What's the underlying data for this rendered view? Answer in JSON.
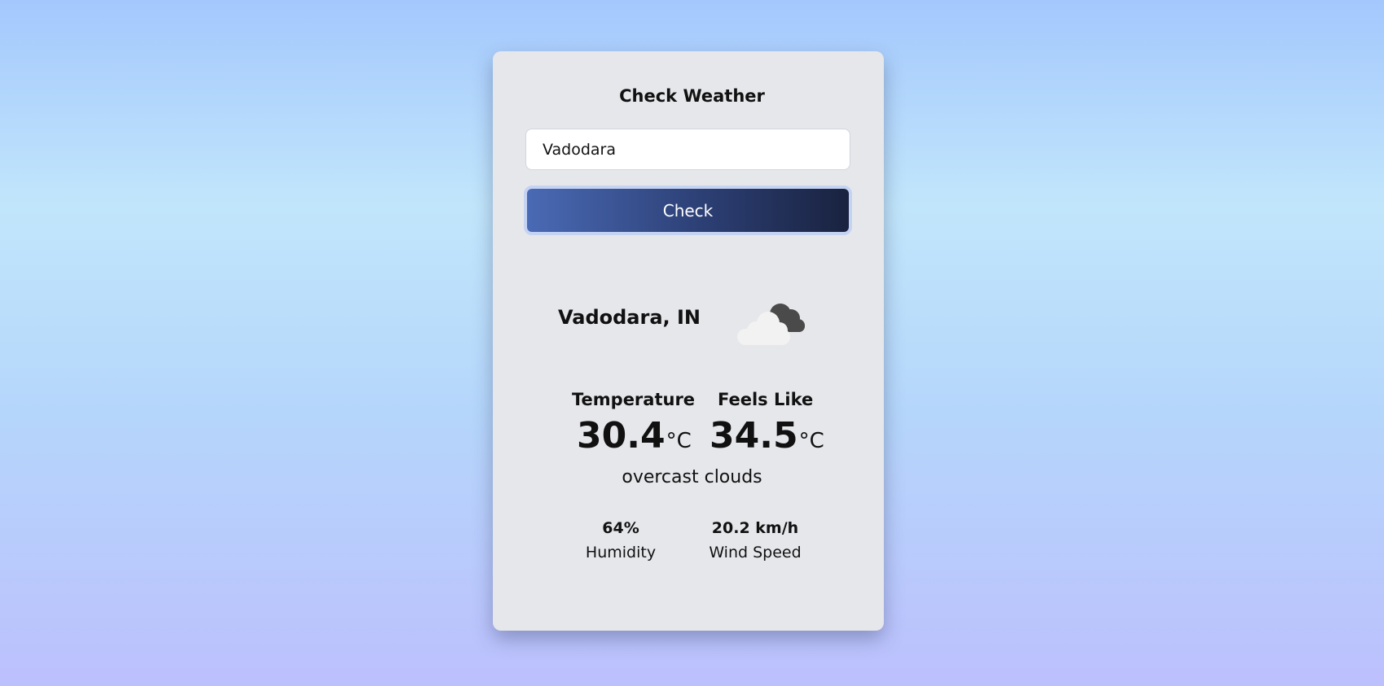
{
  "form": {
    "title": "Check Weather",
    "city_value": "Vadodara",
    "button_label": "Check"
  },
  "result": {
    "location": "Vadodara, IN",
    "icon": "overcast-clouds-icon",
    "temperature": {
      "label": "Temperature",
      "value": "30.4",
      "unit": "°C"
    },
    "feels_like": {
      "label": "Feels Like",
      "value": "34.5",
      "unit": "°C"
    },
    "description": "overcast clouds",
    "humidity": {
      "value": "64%",
      "label": "Humidity"
    },
    "wind_speed": {
      "value": "20.2 km/h",
      "label": "Wind Speed"
    }
  },
  "colors": {
    "card": "#e5e7eb",
    "button_start": "#4a6ab5",
    "button_end": "#19223f",
    "background_top": "#a4c8fd",
    "background_bottom": "#bcc0fd"
  }
}
